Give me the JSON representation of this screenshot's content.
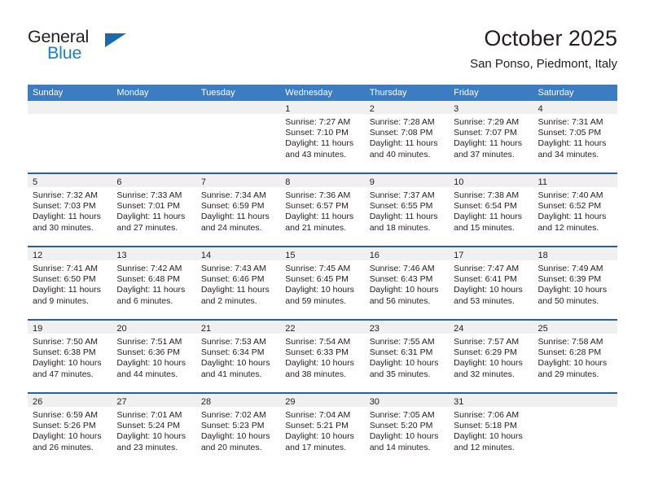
{
  "brand": {
    "name_top": "General",
    "name_bottom": "Blue",
    "accent_color": "#1f7fc4"
  },
  "header": {
    "title": "October 2025",
    "location": "San Ponso, Piedmont, Italy"
  },
  "colors": {
    "header_row_bg": "#3b7dc0",
    "week_separator": "#2c5f93",
    "day_band_bg": "#f0f0f0",
    "text": "#231f20"
  },
  "weekdays": [
    "Sunday",
    "Monday",
    "Tuesday",
    "Wednesday",
    "Thursday",
    "Friday",
    "Saturday"
  ],
  "weeks": [
    [
      {
        "day": "",
        "lines": []
      },
      {
        "day": "",
        "lines": []
      },
      {
        "day": "",
        "lines": []
      },
      {
        "day": "1",
        "lines": [
          "Sunrise: 7:27 AM",
          "Sunset: 7:10 PM",
          "Daylight: 11 hours",
          "and 43 minutes."
        ]
      },
      {
        "day": "2",
        "lines": [
          "Sunrise: 7:28 AM",
          "Sunset: 7:08 PM",
          "Daylight: 11 hours",
          "and 40 minutes."
        ]
      },
      {
        "day": "3",
        "lines": [
          "Sunrise: 7:29 AM",
          "Sunset: 7:07 PM",
          "Daylight: 11 hours",
          "and 37 minutes."
        ]
      },
      {
        "day": "4",
        "lines": [
          "Sunrise: 7:31 AM",
          "Sunset: 7:05 PM",
          "Daylight: 11 hours",
          "and 34 minutes."
        ]
      }
    ],
    [
      {
        "day": "5",
        "lines": [
          "Sunrise: 7:32 AM",
          "Sunset: 7:03 PM",
          "Daylight: 11 hours",
          "and 30 minutes."
        ]
      },
      {
        "day": "6",
        "lines": [
          "Sunrise: 7:33 AM",
          "Sunset: 7:01 PM",
          "Daylight: 11 hours",
          "and 27 minutes."
        ]
      },
      {
        "day": "7",
        "lines": [
          "Sunrise: 7:34 AM",
          "Sunset: 6:59 PM",
          "Daylight: 11 hours",
          "and 24 minutes."
        ]
      },
      {
        "day": "8",
        "lines": [
          "Sunrise: 7:36 AM",
          "Sunset: 6:57 PM",
          "Daylight: 11 hours",
          "and 21 minutes."
        ]
      },
      {
        "day": "9",
        "lines": [
          "Sunrise: 7:37 AM",
          "Sunset: 6:55 PM",
          "Daylight: 11 hours",
          "and 18 minutes."
        ]
      },
      {
        "day": "10",
        "lines": [
          "Sunrise: 7:38 AM",
          "Sunset: 6:54 PM",
          "Daylight: 11 hours",
          "and 15 minutes."
        ]
      },
      {
        "day": "11",
        "lines": [
          "Sunrise: 7:40 AM",
          "Sunset: 6:52 PM",
          "Daylight: 11 hours",
          "and 12 minutes."
        ]
      }
    ],
    [
      {
        "day": "12",
        "lines": [
          "Sunrise: 7:41 AM",
          "Sunset: 6:50 PM",
          "Daylight: 11 hours",
          "and 9 minutes."
        ]
      },
      {
        "day": "13",
        "lines": [
          "Sunrise: 7:42 AM",
          "Sunset: 6:48 PM",
          "Daylight: 11 hours",
          "and 6 minutes."
        ]
      },
      {
        "day": "14",
        "lines": [
          "Sunrise: 7:43 AM",
          "Sunset: 6:46 PM",
          "Daylight: 11 hours",
          "and 2 minutes."
        ]
      },
      {
        "day": "15",
        "lines": [
          "Sunrise: 7:45 AM",
          "Sunset: 6:45 PM",
          "Daylight: 10 hours",
          "and 59 minutes."
        ]
      },
      {
        "day": "16",
        "lines": [
          "Sunrise: 7:46 AM",
          "Sunset: 6:43 PM",
          "Daylight: 10 hours",
          "and 56 minutes."
        ]
      },
      {
        "day": "17",
        "lines": [
          "Sunrise: 7:47 AM",
          "Sunset: 6:41 PM",
          "Daylight: 10 hours",
          "and 53 minutes."
        ]
      },
      {
        "day": "18",
        "lines": [
          "Sunrise: 7:49 AM",
          "Sunset: 6:39 PM",
          "Daylight: 10 hours",
          "and 50 minutes."
        ]
      }
    ],
    [
      {
        "day": "19",
        "lines": [
          "Sunrise: 7:50 AM",
          "Sunset: 6:38 PM",
          "Daylight: 10 hours",
          "and 47 minutes."
        ]
      },
      {
        "day": "20",
        "lines": [
          "Sunrise: 7:51 AM",
          "Sunset: 6:36 PM",
          "Daylight: 10 hours",
          "and 44 minutes."
        ]
      },
      {
        "day": "21",
        "lines": [
          "Sunrise: 7:53 AM",
          "Sunset: 6:34 PM",
          "Daylight: 10 hours",
          "and 41 minutes."
        ]
      },
      {
        "day": "22",
        "lines": [
          "Sunrise: 7:54 AM",
          "Sunset: 6:33 PM",
          "Daylight: 10 hours",
          "and 38 minutes."
        ]
      },
      {
        "day": "23",
        "lines": [
          "Sunrise: 7:55 AM",
          "Sunset: 6:31 PM",
          "Daylight: 10 hours",
          "and 35 minutes."
        ]
      },
      {
        "day": "24",
        "lines": [
          "Sunrise: 7:57 AM",
          "Sunset: 6:29 PM",
          "Daylight: 10 hours",
          "and 32 minutes."
        ]
      },
      {
        "day": "25",
        "lines": [
          "Sunrise: 7:58 AM",
          "Sunset: 6:28 PM",
          "Daylight: 10 hours",
          "and 29 minutes."
        ]
      }
    ],
    [
      {
        "day": "26",
        "lines": [
          "Sunrise: 6:59 AM",
          "Sunset: 5:26 PM",
          "Daylight: 10 hours",
          "and 26 minutes."
        ]
      },
      {
        "day": "27",
        "lines": [
          "Sunrise: 7:01 AM",
          "Sunset: 5:24 PM",
          "Daylight: 10 hours",
          "and 23 minutes."
        ]
      },
      {
        "day": "28",
        "lines": [
          "Sunrise: 7:02 AM",
          "Sunset: 5:23 PM",
          "Daylight: 10 hours",
          "and 20 minutes."
        ]
      },
      {
        "day": "29",
        "lines": [
          "Sunrise: 7:04 AM",
          "Sunset: 5:21 PM",
          "Daylight: 10 hours",
          "and 17 minutes."
        ]
      },
      {
        "day": "30",
        "lines": [
          "Sunrise: 7:05 AM",
          "Sunset: 5:20 PM",
          "Daylight: 10 hours",
          "and 14 minutes."
        ]
      },
      {
        "day": "31",
        "lines": [
          "Sunrise: 7:06 AM",
          "Sunset: 5:18 PM",
          "Daylight: 10 hours",
          "and 12 minutes."
        ]
      },
      {
        "day": "",
        "lines": []
      }
    ]
  ]
}
